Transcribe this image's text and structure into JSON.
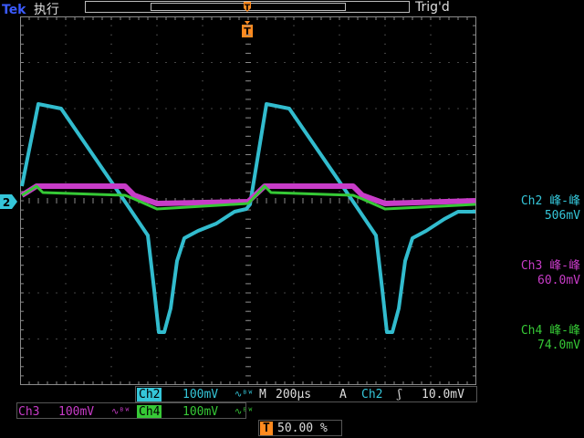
{
  "header": {
    "brand": "Tek",
    "run_state": "执行",
    "trigger_status": "Trig'd"
  },
  "markers": {
    "trigger_position": "T",
    "ch2_ground": "2",
    "trigger_level_bottom": "T"
  },
  "measurements": [
    {
      "channel": "Ch2",
      "label": "Ch2 峰-峰",
      "value": "506mV",
      "color": "#35c6d9"
    },
    {
      "channel": "Ch3",
      "label": "Ch3 峰-峰",
      "value": "60.0mV",
      "color": "#c83cc8"
    },
    {
      "channel": "Ch4",
      "label": "Ch4 峰-峰",
      "value": "74.0mV",
      "color": "#36c936"
    }
  ],
  "status": {
    "ch2_name": "Ch2",
    "ch2_scale": "100mV",
    "ch3_name": "Ch3",
    "ch3_scale": "100mV",
    "ch4_name": "Ch4",
    "ch4_scale": "100mV",
    "bw_limit_symbol": "∿ᴮᵂ",
    "timebase_label": "M",
    "timebase": "200µs",
    "trigger_mode": "A",
    "trigger_source": "Ch2",
    "trigger_slope": "ʃ",
    "trigger_level": "10.0mV",
    "trigger_position_pct": "50.00 %"
  },
  "colors": {
    "ch2": "#35c6d9",
    "ch3": "#c83cc8",
    "ch4": "#36c936",
    "trigger": "#ff8a1f",
    "grid": "#8a8a8a"
  }
}
